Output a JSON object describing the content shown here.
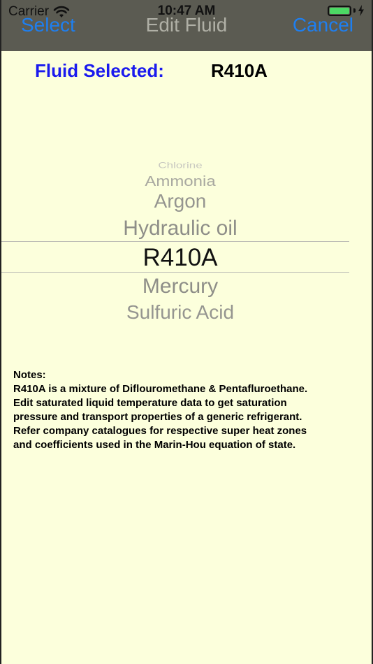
{
  "status_bar": {
    "carrier": "Carrier",
    "time": "10:47 AM",
    "battery_level": 1.0
  },
  "nav": {
    "left_label": "Select",
    "title": "Edit Fluid",
    "right_label": "Cancel"
  },
  "selected": {
    "label": "Fluid Selected:",
    "value": "R410A"
  },
  "picker": {
    "items": [
      "Chlorine",
      "Ammonia",
      "Argon",
      "Hydraulic oil",
      "R410A",
      "Mercury",
      "Sulfuric Acid"
    ],
    "selected_index": 4
  },
  "notes": {
    "heading": "Notes:",
    "lines": [
      "R410A is a mixture of Diflouromethane & Pentafluroethane.",
      "Edit saturated liquid temperature data to get saturation",
      "pressure and transport properties of a generic refrigerant.",
      "Refer company catalogues for respective super heat zones",
      "and coefficients used in the Marin-Hou equation of state."
    ]
  },
  "colors": {
    "background": "#fcffdc",
    "navbar": "#5b5b52",
    "accent": "#1e7ff0",
    "label": "#1a1aee"
  },
  "icons": [
    "wifi-icon",
    "battery-icon",
    "charging-bolt-icon"
  ]
}
